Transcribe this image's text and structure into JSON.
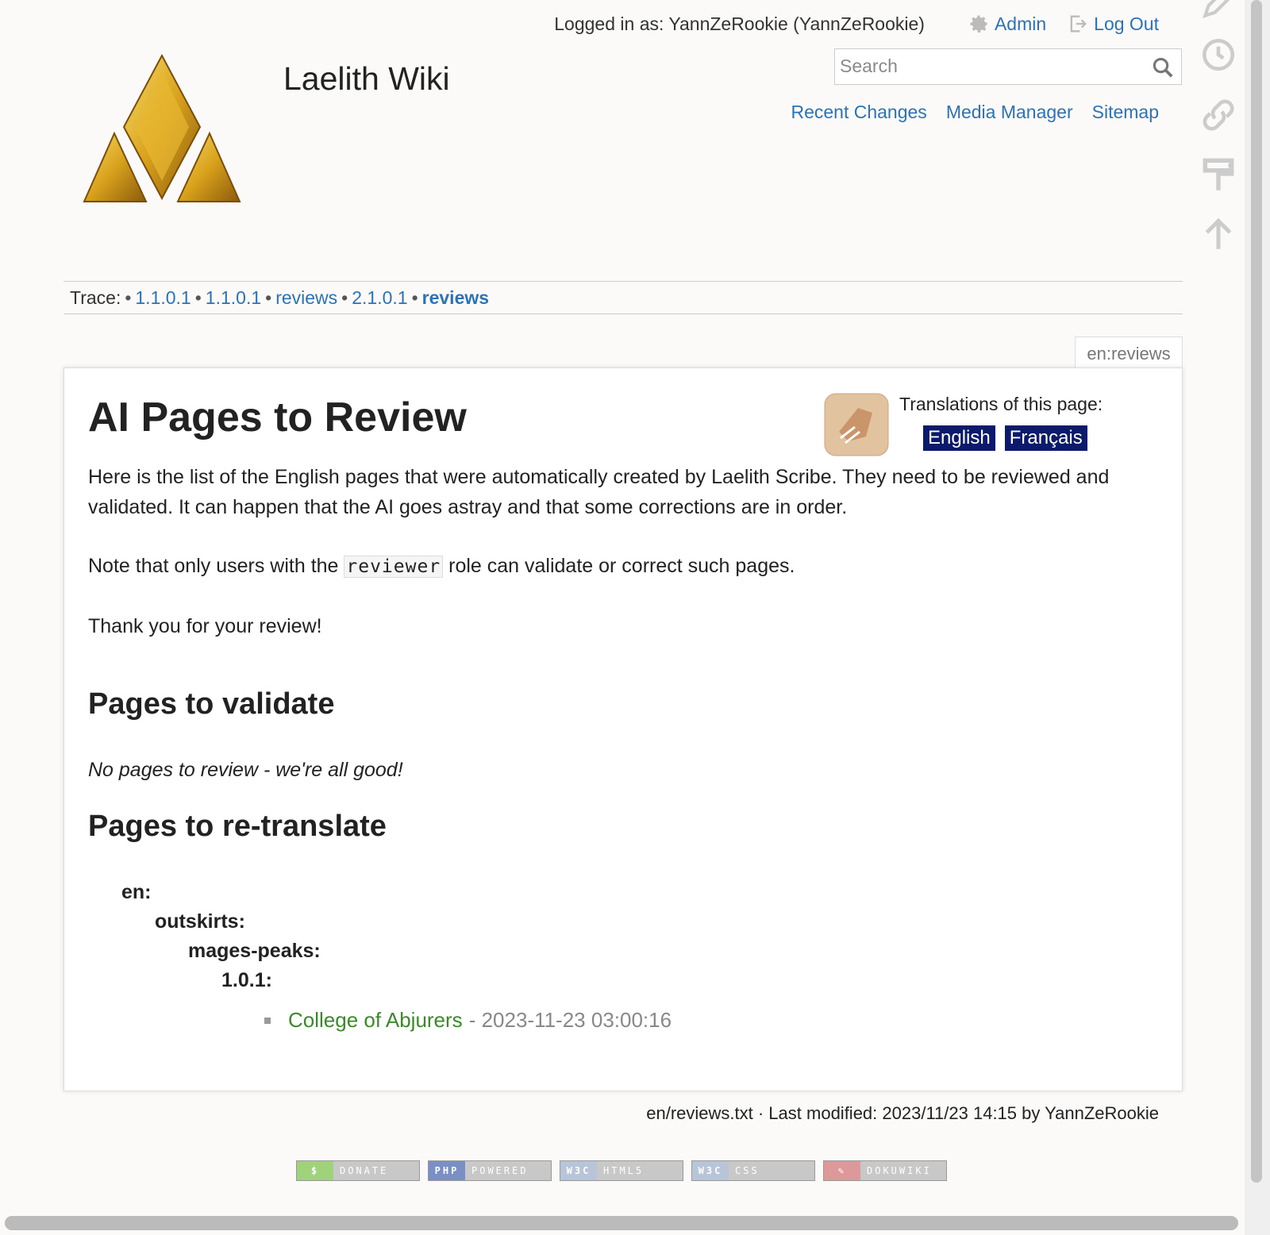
{
  "header": {
    "login_text": "Logged in as: YannZeRookie (YannZeRookie)",
    "admin_label": "Admin",
    "logout_label": "Log Out",
    "site_title": "Laelith Wiki",
    "search_placeholder": "Search",
    "site_tools": [
      "Recent Changes",
      "Media Manager",
      "Sitemap"
    ]
  },
  "breadcrumb": {
    "label": "Trace:",
    "items": [
      "1.1.0.1",
      "1.1.0.1",
      "reviews",
      "2.1.0.1",
      "reviews"
    ]
  },
  "page": {
    "id": "en:reviews",
    "title": "AI Pages to Review",
    "translations_label": "Translations of this page:",
    "languages": [
      "English",
      "Français"
    ],
    "intro": "Here is the list of the English pages that were automatically created by Laelith Scribe. They need to be reviewed and validated. It can happen that the AI goes astray and that some corrections are in order.",
    "note_before": "Note that only users with the ",
    "note_code": "reviewer",
    "note_after": " role can validate or correct such pages.",
    "thanks": "Thank you for your review!",
    "section_validate": "Pages to validate",
    "validate_empty": "No pages to review - we're all good!",
    "section_retranslate": "Pages to re-translate",
    "tree": [
      "en:",
      "outskirts:",
      "mages-peaks:",
      "1.0.1:"
    ],
    "entry_link": "College of Abjurers",
    "entry_date": "- 2023-11-23 03:00:16"
  },
  "footer": {
    "docinfo": "en/reviews.txt · Last modified: 2023/11/23 14:15 by YannZeRookie",
    "badges": [
      {
        "left": "$",
        "right": "DONATE",
        "color": "#9fd27a"
      },
      {
        "left": "PHP",
        "right": "POWERED",
        "color": "#7a8fc4"
      },
      {
        "left": "W3C",
        "right": "HTML5",
        "color": "#b8c4d8"
      },
      {
        "left": "W3C",
        "right": "CSS",
        "color": "#b8c4d8"
      },
      {
        "left": "✎",
        "right": "DOKUWIKI",
        "color": "#d99"
      }
    ]
  },
  "icons": {
    "admin": "gear-icon",
    "logout": "logout-icon",
    "search": "search-icon",
    "page_tools": [
      "edit-icon",
      "history-icon",
      "backlinks-icon",
      "format-icon",
      "top-icon"
    ]
  },
  "colors": {
    "link": "#2b73b7",
    "lang_badge": "#0b1a6b",
    "entry_link": "#3a8a2a"
  }
}
